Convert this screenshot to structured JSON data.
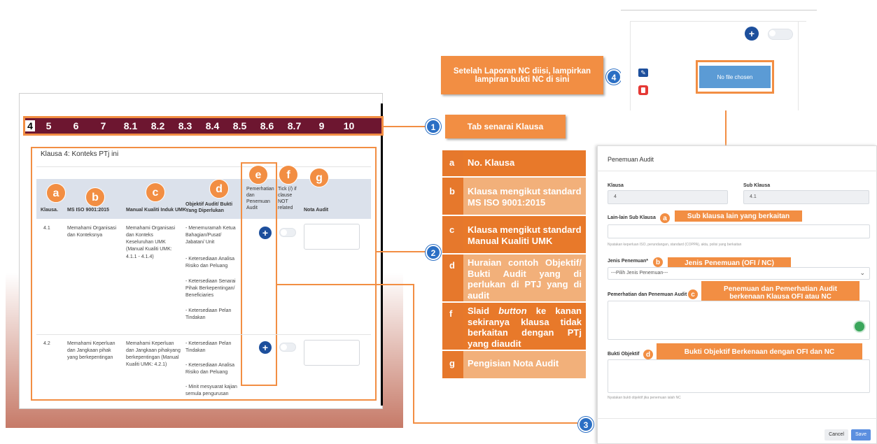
{
  "tabs": [
    "4",
    "5",
    "6",
    "7",
    "8.1",
    "8.2",
    "8.3",
    "8.4",
    "8.5",
    "8.6",
    "8.7",
    "9",
    "10"
  ],
  "clause_title": "Klausa 4: Konteks PTj ini",
  "columns": {
    "klausa": "Klausa.",
    "ms": "MS ISO 9001:2015",
    "manual": "Manual Kualiti Induk UMK",
    "objektif": "Objektif Audit/ Bukti Yang Diperlukan",
    "pemerhatian": "Pemerhatian dan Penemuan Audit",
    "tick": "Tick (/) if clause NOT related",
    "nota": "Nota Audit"
  },
  "column_letters": [
    "a",
    "b",
    "c",
    "d",
    "e",
    "f",
    "g"
  ],
  "rows": [
    {
      "klausa": "4.1",
      "ms": "Memahami Organisasi dan Konteksnya",
      "manual": "Memahami Organisasi dan Konteks Keseluruhan UMK (Manual Kualiti UMK: 4.1.1 - 4.1.4)",
      "objektif": [
        "- Menemuramah Ketua Bahagian/Pusat/ Jabatan/ Unit",
        "- Ketersediaan Analisa Risiko dan Peluang",
        "- Ketersediaan Senarai Pihak Berkepentingan/ Beneficiaries",
        "- Ketersediaan Pelan Tindakan"
      ]
    },
    {
      "klausa": "4.2",
      "ms": "Memahami Keperluan dan Jangkaan pihak yang berkepentingan",
      "manual": "Memahami Keperluan dan Jangkaan pihakyang berkepentingan (Manual Kualiti UMK: 4.2.1)",
      "objektif": [
        "- Ketersediaan Pelan Tindakan",
        "- Ketersediaan Analisa Risiko dan Peluang",
        "- Minit mesyuarat kajian semula pengurusan"
      ]
    }
  ],
  "callouts": {
    "c1_num": "1",
    "c1_text": "Tab senarai Klausa",
    "c2_num": "2",
    "c3_num": "3",
    "c4_num": "4",
    "c4_text": "Setelah Laporan NC diisi, lampirkan lampiran bukti NC di sini"
  },
  "legend": [
    {
      "key": "a",
      "text": "No. Klausa"
    },
    {
      "key": "b",
      "text": "Klausa mengikut standard MS ISO 9001:2015"
    },
    {
      "key": "c",
      "text": "Klausa mengikut standard Manual Kualiti UMK"
    },
    {
      "key": "d",
      "text": "Huraian contoh Objektif/ Bukti Audit yang di perlukan di PTJ yang di audit"
    },
    {
      "key": "f",
      "text_pre": "Slaid ",
      "text_em": "button",
      "text_post": " ke kanan sekiranya klausa tidak berkaitan dengan PTj yang diaudit"
    },
    {
      "key": "g",
      "text": "Pengisian Nota Audit"
    }
  ],
  "file_button": "No file chosen",
  "form": {
    "title": "Penemuan Audit",
    "klausa_label": "Klausa",
    "klausa_value": "4",
    "sub_label": "Sub Klausa",
    "sub_value": "4.1",
    "lain_label": "Lain-lain Sub Klausa",
    "lain_hint": "Nyatakan keperluan ISO, perundangan, standard (COPPA), akta, polisi yang berkaitan",
    "jenis_label": "Jenis Penemuan*",
    "jenis_value": "---Pilih Jenis Penemuan---",
    "pemerhatian_label": "Pemerhatian dan Penemuan Audit *",
    "bukti_label": "Bukti Objektif",
    "bukti_hint": "Nyatakan bukti objektif jika penemuan ialah NC",
    "cancel": "Cancel",
    "save": "Save"
  },
  "form_annotations": {
    "a_letter": "a",
    "a_text": "Sub klausa lain yang berkaitan",
    "b_letter": "b",
    "b_text": "Jenis Penemuan (OFI / NC)",
    "c_letter": "c",
    "c_text": "Penemuan dan Pemerhatian Audit berkenaan  Klausa OFI atau NC",
    "d_letter": "d",
    "d_text": "Bukti Objektif Berkenaan dengan OFI dan NC"
  },
  "colors": {
    "accent": "#f28e43",
    "tabbar": "#6d1630",
    "blue": "#2b6fc4"
  }
}
